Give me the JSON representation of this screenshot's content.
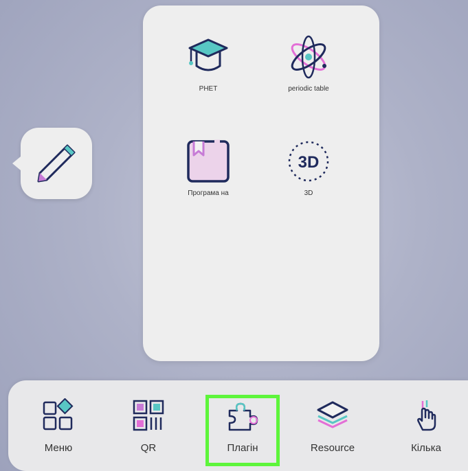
{
  "side_tool": {
    "icon": "pencil-icon"
  },
  "plugin_panel": {
    "apps": [
      {
        "label": "PHET",
        "icon": "graduation-cap-icon"
      },
      {
        "label": "periodic table",
        "icon": "atom-icon"
      },
      {
        "label": "Програма на",
        "icon": "bookmark-book-icon"
      },
      {
        "label": "3D",
        "icon": "3d-icon",
        "icon_text": "3D"
      }
    ]
  },
  "dock": {
    "items": [
      {
        "label": "Меню",
        "icon": "grid-menu-icon"
      },
      {
        "label": "QR",
        "icon": "qr-code-icon"
      },
      {
        "label": "Плагін",
        "icon": "puzzle-icon",
        "selected": true
      },
      {
        "label": "Resource",
        "icon": "layers-icon"
      },
      {
        "label": "Кілька",
        "icon": "multi-touch-hand-icon"
      }
    ]
  },
  "colors": {
    "selection_outline": "#5df53b",
    "accent_pink": "#e36fd6",
    "accent_teal": "#58c7c4",
    "ink": "#1f2a5c"
  }
}
